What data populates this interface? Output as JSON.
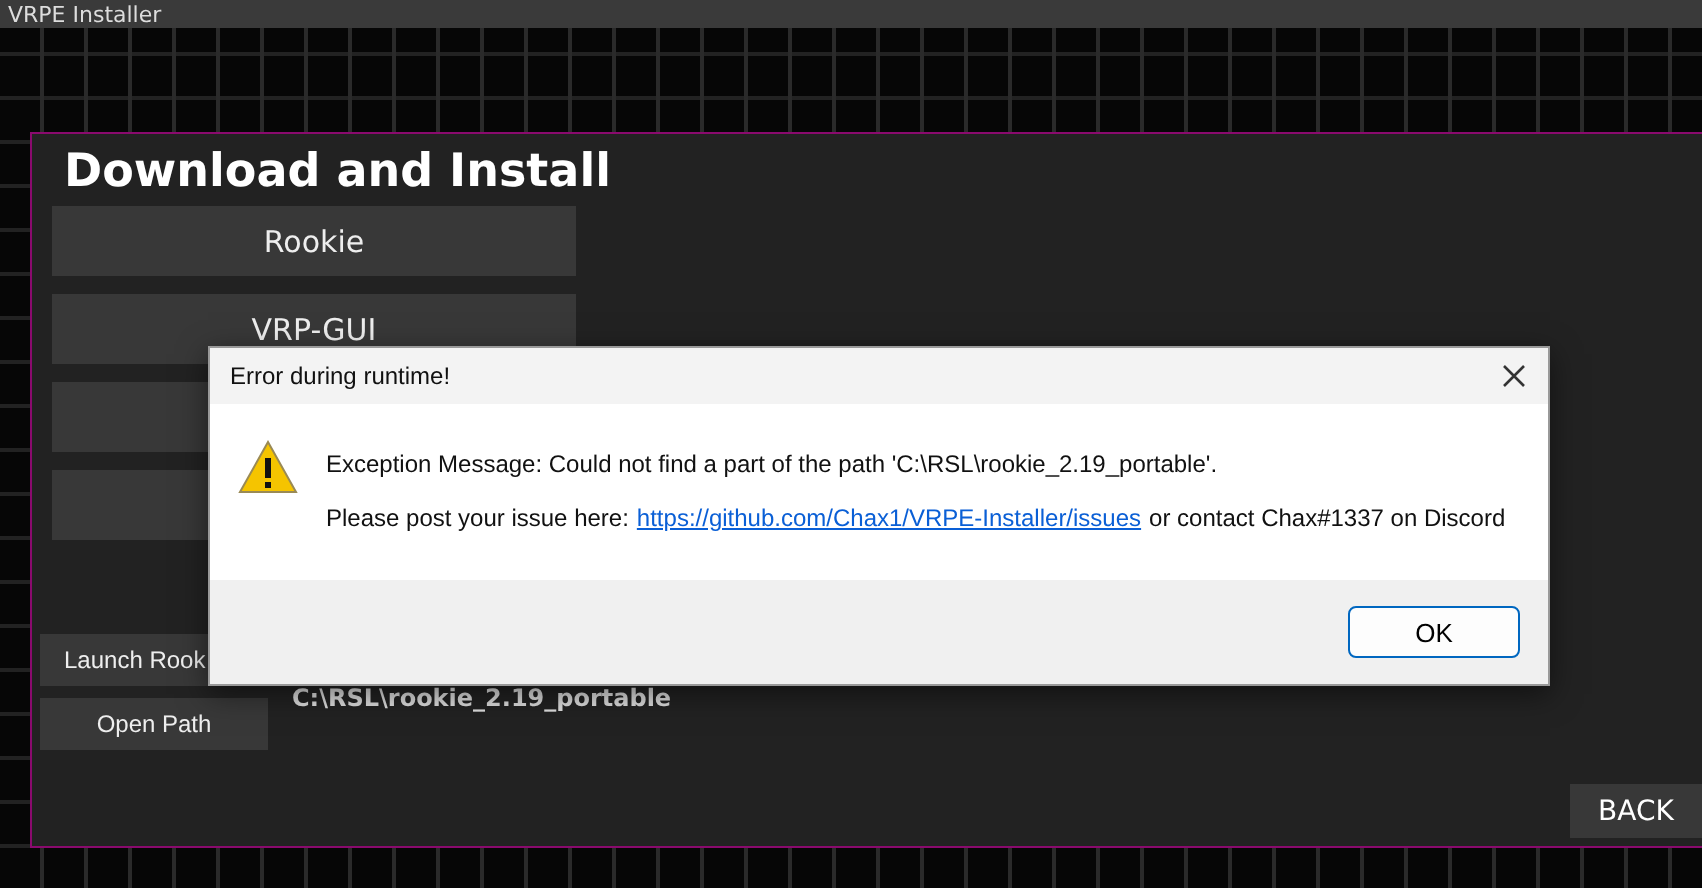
{
  "window": {
    "title": "VRPE Installer"
  },
  "panel": {
    "heading": "Download and Install",
    "install_buttons": [
      {
        "label": "Rookie"
      },
      {
        "label": "VRP-GUI"
      }
    ],
    "launch_button": "Launch Rook",
    "open_path_button": "Open Path",
    "path": "C:\\RSL\\rookie_2.19_portable",
    "back_button": "BACK"
  },
  "dialog": {
    "title": "Error during runtime!",
    "message": "Exception Message: Could not find a part of the path 'C:\\RSL\\rookie_2.19_portable'.",
    "issue_prefix": "Please post your issue here:",
    "issue_link": "https://github.com/Chax1/VRPE-Installer/issues",
    "issue_suffix": "or contact Chax#1337 on Discord",
    "ok_button": "OK"
  }
}
